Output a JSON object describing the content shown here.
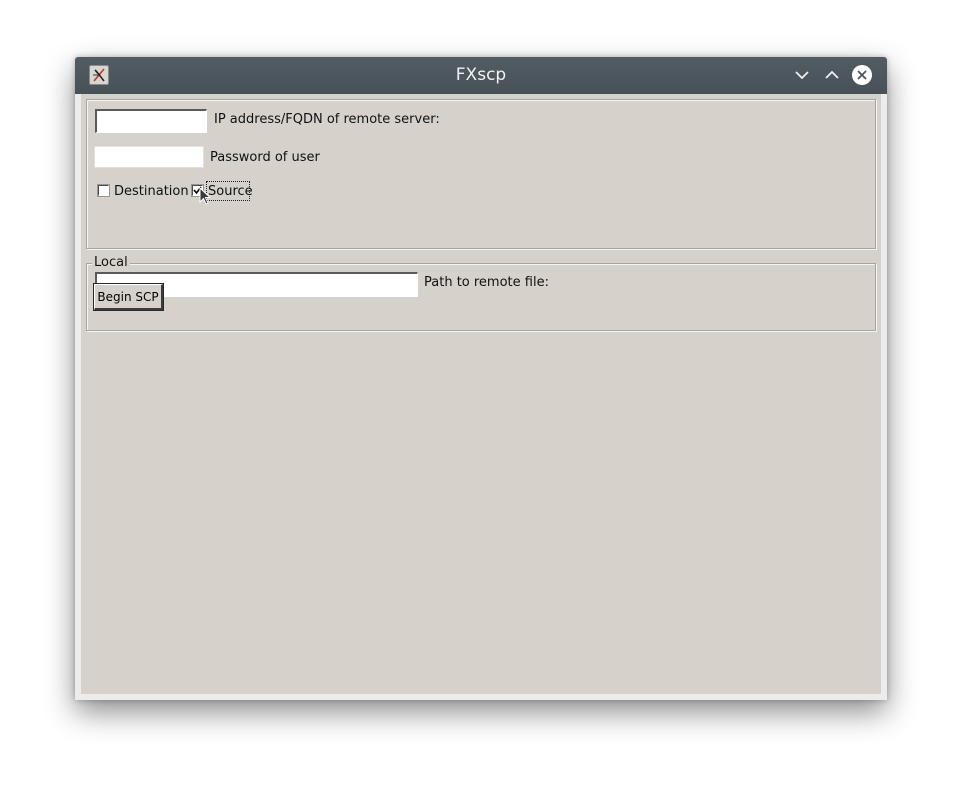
{
  "window": {
    "title": "FXscp",
    "icon": "tk-feather-icon",
    "controls": [
      "minimize-icon",
      "maximize-icon",
      "close-icon"
    ]
  },
  "remote": {
    "ip_field": {
      "label": "IP address/FQDN of remote server:",
      "value": ""
    },
    "password_field": {
      "label": "Password of user",
      "value": ""
    },
    "destination_checkbox": {
      "label": "Destination",
      "checked": false
    },
    "source_checkbox": {
      "label": "Source",
      "checked": true
    },
    "path_field": {
      "label": "Path to remote file:",
      "value": ""
    }
  },
  "local": {
    "legend": "Local",
    "begin_button": "Begin SCP"
  },
  "colors": {
    "titlebar": "#4b555c",
    "background": "#d6d2cb",
    "close_button": "#ffffff"
  }
}
